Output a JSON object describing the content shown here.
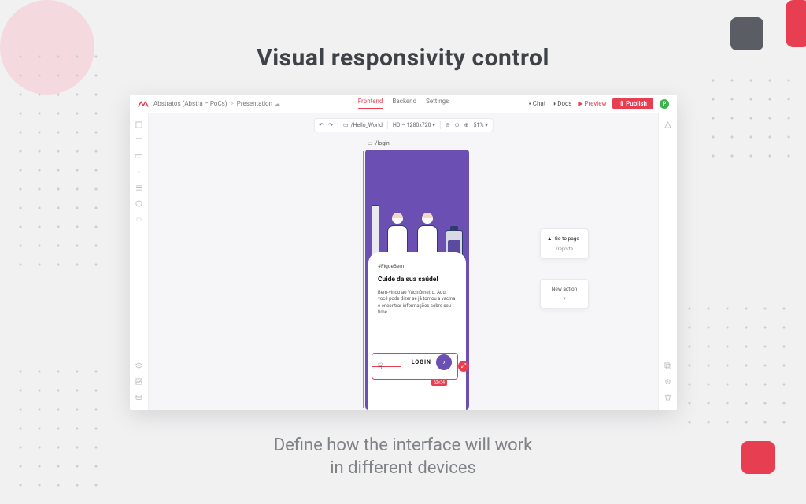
{
  "hero": {
    "title": "Visual responsivity control",
    "subtitle_l1": "Define how the interface will work",
    "subtitle_l2": "in different devices"
  },
  "topbar": {
    "workspace": "Abstratos (Abstra – PoCs)",
    "sep": ">",
    "project": "Presentation",
    "tabs": {
      "frontend": "Frontend",
      "backend": "Backend",
      "settings": "Settings"
    },
    "chat": "Chat",
    "docs": "Docs",
    "preview": "Preview",
    "publish": "Publish",
    "avatar_initial": "P"
  },
  "devicebar": {
    "route": "/Hello_World",
    "device": "HD – 1280x720",
    "zoom": "51%"
  },
  "canvas": {
    "page_label": "/login"
  },
  "mockup": {
    "hashtag": "#FiqueBem",
    "heading": "Cuide da sua saúde!",
    "body": "Bem-vindo ao Vacinômetro. Aqui você pode dizer se já tomou a vacina e encontrar informações sobre seu time.",
    "login_label": "LOGIN",
    "size_badge": "62×34"
  },
  "floaters": {
    "goto_title": "Go to page",
    "goto_route": "/reporte",
    "new_action": "New action"
  }
}
